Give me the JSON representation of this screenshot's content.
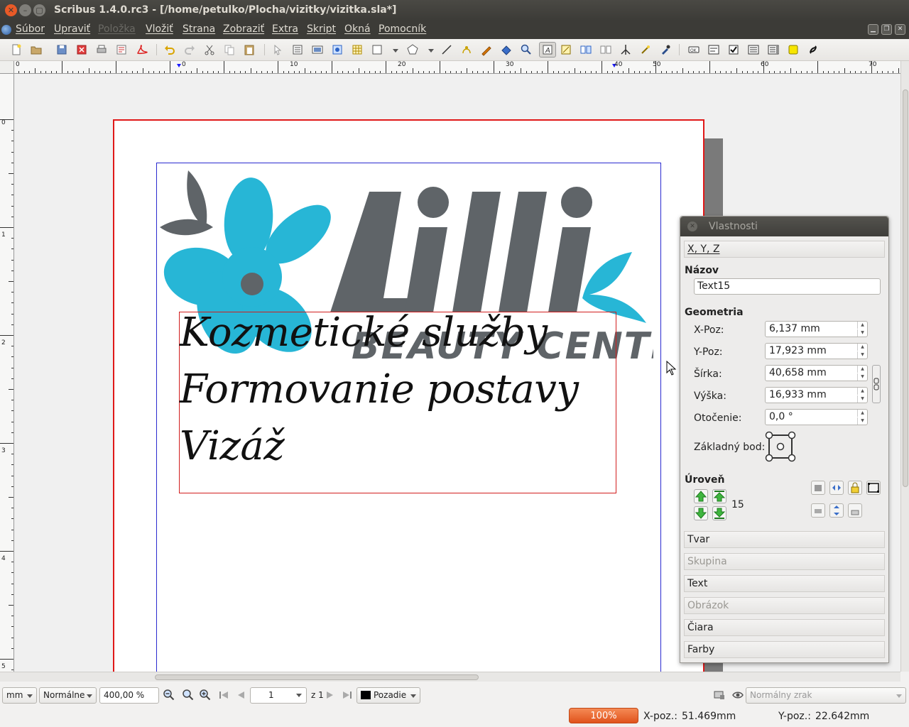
{
  "window": {
    "title": "Scribus 1.4.0.rc3 - [/home/petulko/Plocha/vizitky/vizitka.sla*]"
  },
  "menubar": {
    "items": [
      "Súbor",
      "Upraviť",
      "Položka",
      "Vložiť",
      "Strana",
      "Zobraziť",
      "Extra",
      "Skript",
      "Okná",
      "Pomocník"
    ]
  },
  "ruler": {
    "h_labels": [
      "0",
      "0",
      "10",
      "20",
      "30",
      "40",
      "50",
      "60",
      "70"
    ],
    "v_labels": [
      "0",
      "1",
      "2",
      "3",
      "4",
      "5"
    ]
  },
  "document": {
    "logo": {
      "name": "Lilli",
      "tagline": "BEAUTY CENTRE"
    },
    "text_lines": [
      "Kozmetické služby",
      "Formovanie postavy",
      "Vizáž"
    ]
  },
  "properties": {
    "title": "Vlastnosti",
    "xyz_section": "X, Y, Z",
    "name_label": "Názov",
    "name_value": "Text15",
    "geometry_label": "Geometria",
    "fields": [
      {
        "label": "X-Poz:",
        "value": "6,137 mm"
      },
      {
        "label": "Y-Poz:",
        "value": "17,923 mm"
      },
      {
        "label": "Šírka:",
        "value": "40,658 mm"
      },
      {
        "label": "Výška:",
        "value": "16,933 mm"
      },
      {
        "label": "Otočenie:",
        "value": "0,0 °"
      }
    ],
    "basepoint_label": "Základný bod:",
    "level_label": "Úroveň",
    "level_value": "15",
    "sections": [
      {
        "label": "Tvar",
        "enabled": true
      },
      {
        "label": "Skupina",
        "enabled": false
      },
      {
        "label": "Text",
        "enabled": true
      },
      {
        "label": "Obrázok",
        "enabled": false
      },
      {
        "label": "Čiara",
        "enabled": true
      },
      {
        "label": "Farby",
        "enabled": true
      }
    ]
  },
  "bottombar": {
    "unit": "mm",
    "mode": "Normálne",
    "zoom": "400,00 %",
    "page_number": "1",
    "page_of": "z 1",
    "layer": "Pozadie",
    "view_mode": "Normálny zrak"
  },
  "statusbar": {
    "progress": "100%",
    "x_label": "X-poz.:",
    "x_value": "51.469mm",
    "y_label": "Y-poz.:",
    "y_value": "22.642mm"
  },
  "colors": {
    "accent": "#e0531c",
    "logo_blue": "#27b6d6",
    "logo_gray": "#5f6468",
    "frame_red": "#d21e1e",
    "margin_blue": "#2a2ad0"
  }
}
